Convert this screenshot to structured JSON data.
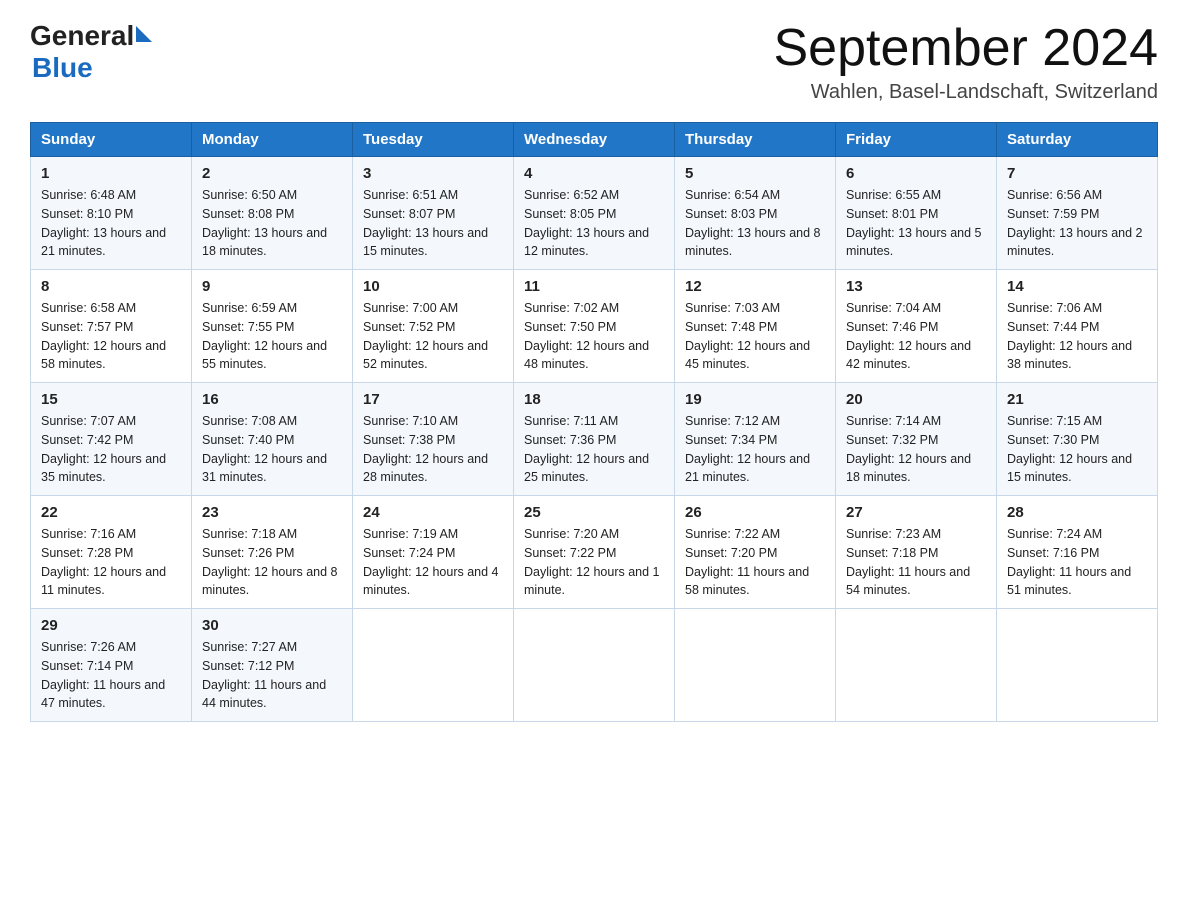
{
  "header": {
    "logo_general": "General",
    "logo_blue": "Blue",
    "month_title": "September 2024",
    "location": "Wahlen, Basel-Landschaft, Switzerland"
  },
  "days_of_week": [
    "Sunday",
    "Monday",
    "Tuesday",
    "Wednesday",
    "Thursday",
    "Friday",
    "Saturday"
  ],
  "weeks": [
    [
      {
        "day": "1",
        "sunrise": "6:48 AM",
        "sunset": "8:10 PM",
        "daylight": "13 hours and 21 minutes."
      },
      {
        "day": "2",
        "sunrise": "6:50 AM",
        "sunset": "8:08 PM",
        "daylight": "13 hours and 18 minutes."
      },
      {
        "day": "3",
        "sunrise": "6:51 AM",
        "sunset": "8:07 PM",
        "daylight": "13 hours and 15 minutes."
      },
      {
        "day": "4",
        "sunrise": "6:52 AM",
        "sunset": "8:05 PM",
        "daylight": "13 hours and 12 minutes."
      },
      {
        "day": "5",
        "sunrise": "6:54 AM",
        "sunset": "8:03 PM",
        "daylight": "13 hours and 8 minutes."
      },
      {
        "day": "6",
        "sunrise": "6:55 AM",
        "sunset": "8:01 PM",
        "daylight": "13 hours and 5 minutes."
      },
      {
        "day": "7",
        "sunrise": "6:56 AM",
        "sunset": "7:59 PM",
        "daylight": "13 hours and 2 minutes."
      }
    ],
    [
      {
        "day": "8",
        "sunrise": "6:58 AM",
        "sunset": "7:57 PM",
        "daylight": "12 hours and 58 minutes."
      },
      {
        "day": "9",
        "sunrise": "6:59 AM",
        "sunset": "7:55 PM",
        "daylight": "12 hours and 55 minutes."
      },
      {
        "day": "10",
        "sunrise": "7:00 AM",
        "sunset": "7:52 PM",
        "daylight": "12 hours and 52 minutes."
      },
      {
        "day": "11",
        "sunrise": "7:02 AM",
        "sunset": "7:50 PM",
        "daylight": "12 hours and 48 minutes."
      },
      {
        "day": "12",
        "sunrise": "7:03 AM",
        "sunset": "7:48 PM",
        "daylight": "12 hours and 45 minutes."
      },
      {
        "day": "13",
        "sunrise": "7:04 AM",
        "sunset": "7:46 PM",
        "daylight": "12 hours and 42 minutes."
      },
      {
        "day": "14",
        "sunrise": "7:06 AM",
        "sunset": "7:44 PM",
        "daylight": "12 hours and 38 minutes."
      }
    ],
    [
      {
        "day": "15",
        "sunrise": "7:07 AM",
        "sunset": "7:42 PM",
        "daylight": "12 hours and 35 minutes."
      },
      {
        "day": "16",
        "sunrise": "7:08 AM",
        "sunset": "7:40 PM",
        "daylight": "12 hours and 31 minutes."
      },
      {
        "day": "17",
        "sunrise": "7:10 AM",
        "sunset": "7:38 PM",
        "daylight": "12 hours and 28 minutes."
      },
      {
        "day": "18",
        "sunrise": "7:11 AM",
        "sunset": "7:36 PM",
        "daylight": "12 hours and 25 minutes."
      },
      {
        "day": "19",
        "sunrise": "7:12 AM",
        "sunset": "7:34 PM",
        "daylight": "12 hours and 21 minutes."
      },
      {
        "day": "20",
        "sunrise": "7:14 AM",
        "sunset": "7:32 PM",
        "daylight": "12 hours and 18 minutes."
      },
      {
        "day": "21",
        "sunrise": "7:15 AM",
        "sunset": "7:30 PM",
        "daylight": "12 hours and 15 minutes."
      }
    ],
    [
      {
        "day": "22",
        "sunrise": "7:16 AM",
        "sunset": "7:28 PM",
        "daylight": "12 hours and 11 minutes."
      },
      {
        "day": "23",
        "sunrise": "7:18 AM",
        "sunset": "7:26 PM",
        "daylight": "12 hours and 8 minutes."
      },
      {
        "day": "24",
        "sunrise": "7:19 AM",
        "sunset": "7:24 PM",
        "daylight": "12 hours and 4 minutes."
      },
      {
        "day": "25",
        "sunrise": "7:20 AM",
        "sunset": "7:22 PM",
        "daylight": "12 hours and 1 minute."
      },
      {
        "day": "26",
        "sunrise": "7:22 AM",
        "sunset": "7:20 PM",
        "daylight": "11 hours and 58 minutes."
      },
      {
        "day": "27",
        "sunrise": "7:23 AM",
        "sunset": "7:18 PM",
        "daylight": "11 hours and 54 minutes."
      },
      {
        "day": "28",
        "sunrise": "7:24 AM",
        "sunset": "7:16 PM",
        "daylight": "11 hours and 51 minutes."
      }
    ],
    [
      {
        "day": "29",
        "sunrise": "7:26 AM",
        "sunset": "7:14 PM",
        "daylight": "11 hours and 47 minutes."
      },
      {
        "day": "30",
        "sunrise": "7:27 AM",
        "sunset": "7:12 PM",
        "daylight": "11 hours and 44 minutes."
      },
      null,
      null,
      null,
      null,
      null
    ]
  ],
  "labels": {
    "sunrise": "Sunrise:",
    "sunset": "Sunset:",
    "daylight": "Daylight:"
  }
}
